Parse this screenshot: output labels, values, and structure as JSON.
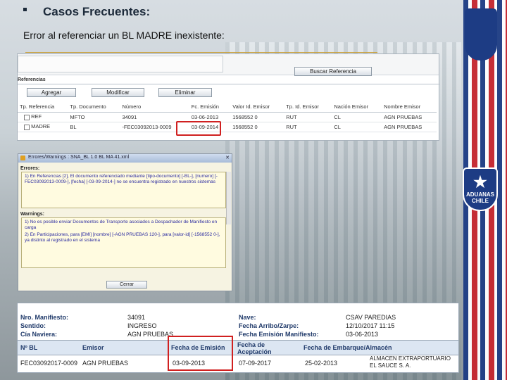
{
  "slide": {
    "title": "Casos Frecuentes:",
    "subtitle": "Error al referenciar un BL MADRE inexistente:"
  },
  "ref_window": {
    "search_button": "Buscar Referencia",
    "section_label": "Referencias",
    "add_button": "Agregar",
    "modify_button": "Modificar",
    "delete_button": "Eliminar",
    "columns": [
      "Tp. Referencia",
      "Tp. Documento",
      "Número",
      "Fc. Emisión",
      "Valor Id. Emisor",
      "Tp. Id. Emisor",
      "Nación Emisor",
      "Nombre Emisor"
    ],
    "rows": [
      [
        "REF",
        "MFTO",
        "34091",
        "03-06-2013",
        "1568552 0",
        "RUT",
        "CL",
        "AGN PRUEBAS"
      ],
      [
        "MADRE",
        "BL",
        "-FEC03092013-0009",
        "03-09-2014",
        "1568552 0",
        "RUT",
        "CL",
        "AGN PRUEBAS"
      ]
    ]
  },
  "errors_window": {
    "title": "Errores/Warnings : SNA_BL 1.0 BL MA 41.xml",
    "errors_label": "Errores:",
    "errors_text": "1) En Referencias [2], El documento referenciado mediante [tipo-documento] [-BL-], [numero] [-FEC03092013-0009-], [fecha] [-03-09-2014-] no se encuentra registrado en nuestros sistemas",
    "warnings_label": "Warnings:",
    "warning_1": "1) No es posible enviar Documentos de Transporte asociados a Despachador de Manifiesto en carga",
    "warning_2": "2) En Participaciones, para [EMI] [nombre] [-AGN PRUEBAS 120-], para [valor-id] [-1568552 0-], ya distinto al registrado en el sistema",
    "close_button": "Cerrar"
  },
  "manifest": {
    "nro_label": "Nro. Manifiesto:",
    "nro_value": "34091",
    "sentido_label": "Sentido:",
    "sentido_value": "INGRESO",
    "cia_label": "Cía Naviera:",
    "cia_value": "AGN PRUEBAS",
    "nave_label": "Nave:",
    "nave_value": "CSAV PAREDIAS",
    "arribo_label": "Fecha Arribo/Zarpe:",
    "arribo_value": "12/10/2017 11:15",
    "emision_label": "Fecha Emisión Manifiesto:",
    "emision_value": "03-06-2013",
    "bl_columns": [
      "Nº BL",
      "Emisor",
      "Fecha de Emisión",
      "Fecha de Aceptación",
      "Fecha de Embarque/Almacén"
    ],
    "bl_row": [
      "FEC03092017-0009",
      "AGN PRUEBAS",
      "03-09-2013",
      "07-09-2017",
      "25-02-2013",
      "ALMACEN EXTRAPORTUARIO EL SAUCE S. A."
    ]
  },
  "branding": {
    "emblem_text": "ADUANAS CHILE"
  },
  "colors": {
    "highlight_red": "#d02020",
    "chile_blue": "#1d3c84",
    "chile_red": "#c6262e"
  }
}
